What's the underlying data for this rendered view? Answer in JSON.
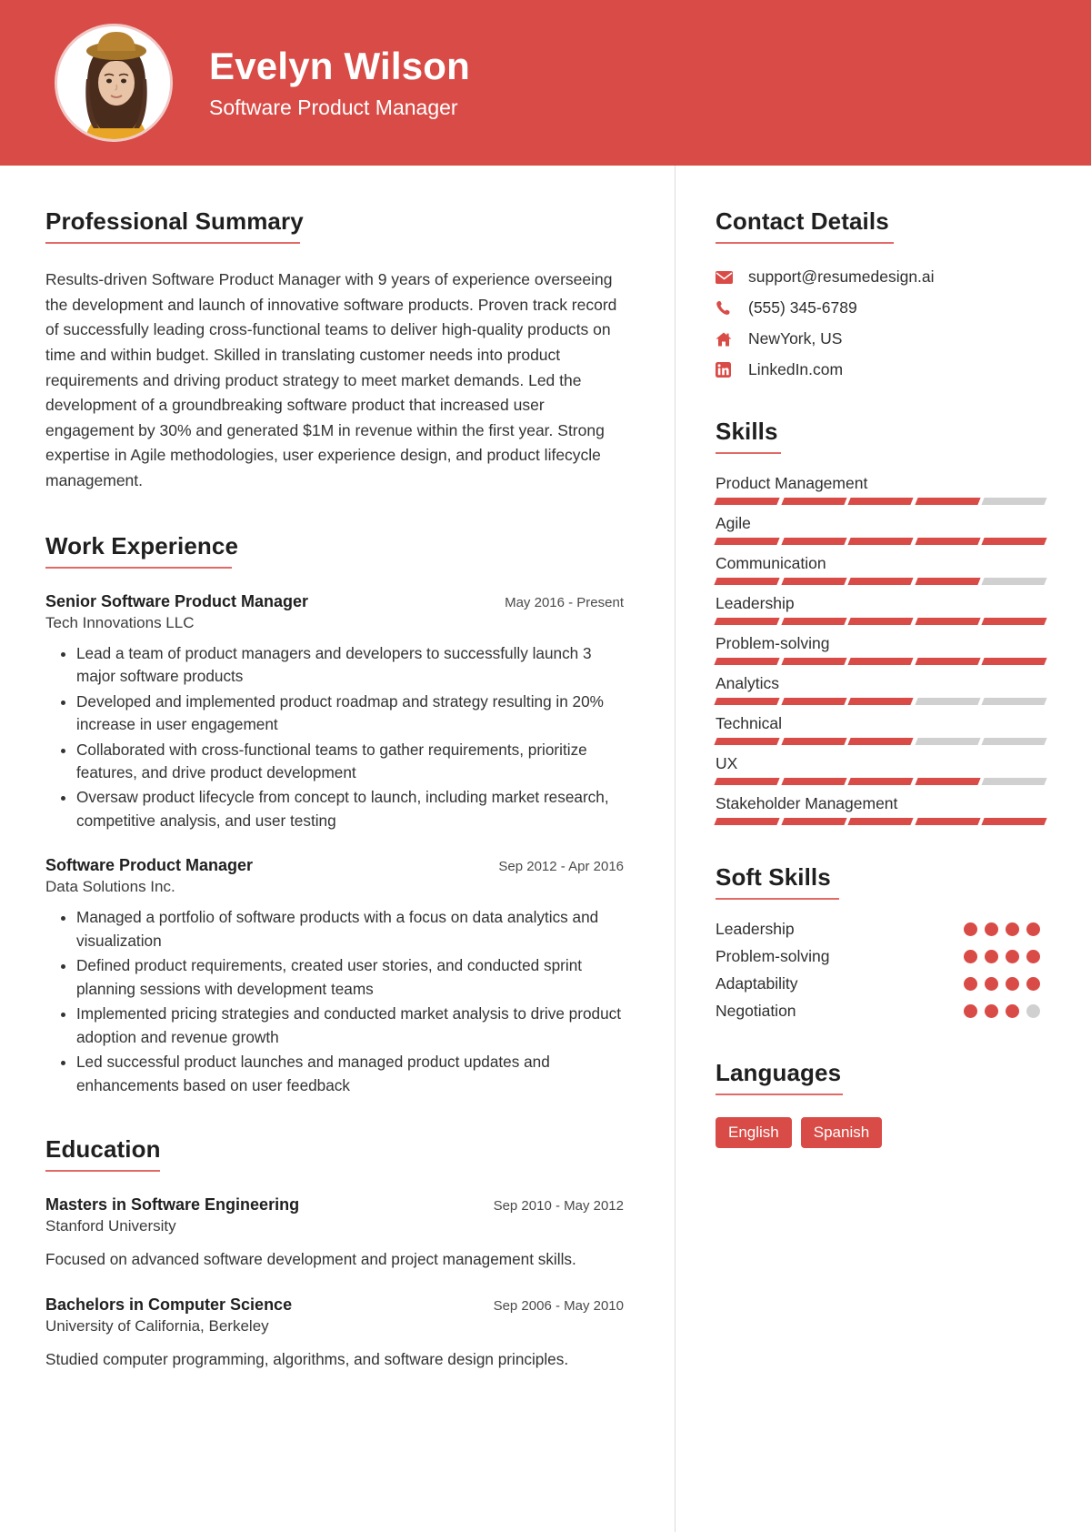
{
  "theme": {
    "accent": "#d94b46",
    "muted": "#d0d0d0",
    "text": "#2b2b2b"
  },
  "header": {
    "name": "Evelyn Wilson",
    "title": "Software Product Manager",
    "avatar_alt": "portrait-photo"
  },
  "summary": {
    "heading": "Professional Summary",
    "text": "Results-driven Software Product Manager with 9 years of experience overseeing the development and launch of innovative software products. Proven track record of successfully leading cross-functional teams to deliver high-quality products on time and within budget. Skilled in translating customer needs into product requirements and driving product strategy to meet market demands. Led the development of a groundbreaking software product that increased user engagement by 30% and generated $1M in revenue within the first year. Strong expertise in Agile methodologies, user experience design, and product lifecycle management."
  },
  "work": {
    "heading": "Work Experience",
    "jobs": [
      {
        "role": "Senior Software Product Manager",
        "date": "May 2016 - Present",
        "company": "Tech Innovations LLC",
        "bullets": [
          "Lead a team of product managers and developers to successfully launch 3 major software products",
          "Developed and implemented product roadmap and strategy resulting in 20% increase in user engagement",
          "Collaborated with cross-functional teams to gather requirements, prioritize features, and drive product development",
          "Oversaw product lifecycle from concept to launch, including market research, competitive analysis, and user testing"
        ]
      },
      {
        "role": "Software Product Manager",
        "date": "Sep 2012 - Apr 2016",
        "company": "Data Solutions Inc.",
        "bullets": [
          "Managed a portfolio of software products with a focus on data analytics and visualization",
          "Defined product requirements, created user stories, and conducted sprint planning sessions with development teams",
          "Implemented pricing strategies and conducted market analysis to drive product adoption and revenue growth",
          "Led successful product launches and managed product updates and enhancements based on user feedback"
        ]
      }
    ]
  },
  "education": {
    "heading": "Education",
    "items": [
      {
        "degree": "Masters in Software Engineering",
        "date": "Sep 2010 - May 2012",
        "school": "Stanford University",
        "description": "Focused on advanced software development and project management skills."
      },
      {
        "degree": "Bachelors in Computer Science",
        "date": "Sep 2006 - May 2010",
        "school": "University of California, Berkeley",
        "description": "Studied computer programming, algorithms, and software design principles."
      }
    ]
  },
  "contact": {
    "heading": "Contact Details",
    "items": [
      {
        "icon": "envelope-icon",
        "value": "support@resumedesign.ai"
      },
      {
        "icon": "phone-icon",
        "value": "(555) 345-6789"
      },
      {
        "icon": "home-icon",
        "value": "NewYork, US"
      },
      {
        "icon": "linkedin-icon",
        "value": "LinkedIn.com"
      }
    ]
  },
  "skills": {
    "heading": "Skills",
    "max": 5,
    "items": [
      {
        "name": "Product Management",
        "level": 4
      },
      {
        "name": "Agile",
        "level": 5
      },
      {
        "name": "Communication",
        "level": 4
      },
      {
        "name": "Leadership",
        "level": 5
      },
      {
        "name": "Problem-solving",
        "level": 5
      },
      {
        "name": "Analytics",
        "level": 3
      },
      {
        "name": "Technical",
        "level": 3
      },
      {
        "name": "UX",
        "level": 4
      },
      {
        "name": "Stakeholder Management",
        "level": 5
      }
    ]
  },
  "soft_skills": {
    "heading": "Soft Skills",
    "max": 4,
    "items": [
      {
        "name": "Leadership",
        "level": 4
      },
      {
        "name": "Problem-solving",
        "level": 4
      },
      {
        "name": "Adaptability",
        "level": 4
      },
      {
        "name": "Negotiation",
        "level": 3
      }
    ]
  },
  "languages": {
    "heading": "Languages",
    "items": [
      "English",
      "Spanish"
    ]
  }
}
